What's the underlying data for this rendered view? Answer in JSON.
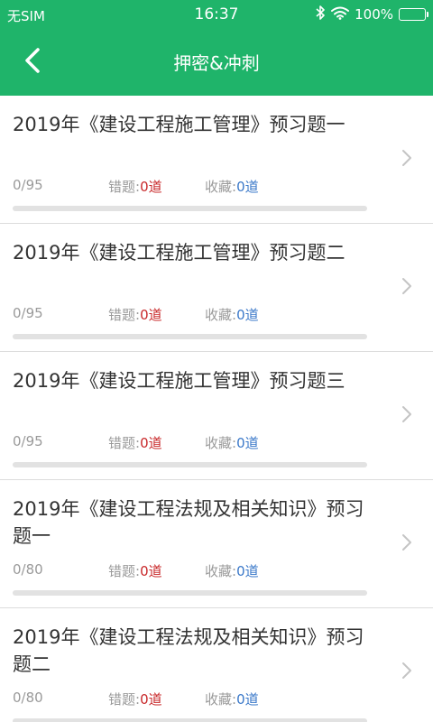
{
  "status_bar": {
    "carrier": "无SIM",
    "time": "16:37",
    "battery": "100%",
    "icons": [
      "bluetooth-icon",
      "wifi-icon",
      "battery-icon"
    ]
  },
  "nav": {
    "title": "押密&冲刺",
    "back_icon": "chevron-left-icon"
  },
  "colors": {
    "brand": "#1fb46a",
    "wrong_value": "#c8282a",
    "fav_value": "#3a78c9"
  },
  "list": {
    "items": [
      {
        "title": "2019年《建设工程施工管理》预习题一",
        "progress": "0/95",
        "progress_fraction": 0,
        "wrong_label": "错题:",
        "wrong_value": "0道",
        "fav_label": "收藏:",
        "fav_value": "0道"
      },
      {
        "title": "2019年《建设工程施工管理》预习题二",
        "progress": "0/95",
        "progress_fraction": 0,
        "wrong_label": "错题:",
        "wrong_value": "0道",
        "fav_label": "收藏:",
        "fav_value": "0道"
      },
      {
        "title": "2019年《建设工程施工管理》预习题三",
        "progress": "0/95",
        "progress_fraction": 0,
        "wrong_label": "错题:",
        "wrong_value": "0道",
        "fav_label": "收藏:",
        "fav_value": "0道"
      },
      {
        "title": "2019年《建设工程法规及相关知识》预习题一",
        "progress": "0/80",
        "progress_fraction": 0,
        "wrong_label": "错题:",
        "wrong_value": "0道",
        "fav_label": "收藏:",
        "fav_value": "0道"
      },
      {
        "title": "2019年《建设工程法规及相关知识》预习题二",
        "progress": "0/80",
        "progress_fraction": 0,
        "wrong_label": "错题:",
        "wrong_value": "0道",
        "fav_label": "收藏:",
        "fav_value": "0道"
      }
    ]
  }
}
